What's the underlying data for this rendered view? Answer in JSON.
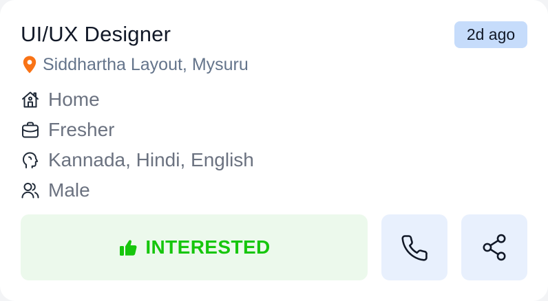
{
  "job": {
    "title": "UI/UX Designer",
    "posted": "2d ago",
    "location": "Siddhartha Layout, Mysuru"
  },
  "details": {
    "work_mode": "Home",
    "experience": "Fresher",
    "languages": "Kannada, Hindi, English",
    "gender": "Male"
  },
  "actions": {
    "interested_label": "INTERESTED",
    "call_icon": "phone-icon",
    "share_icon": "share-icon"
  },
  "colors": {
    "pin": "#f97316",
    "interested_text": "#16c60c",
    "interested_bg": "#ecf9ec",
    "badge_bg": "#c6dcfb",
    "icon_button_bg": "#e8f0fd"
  }
}
